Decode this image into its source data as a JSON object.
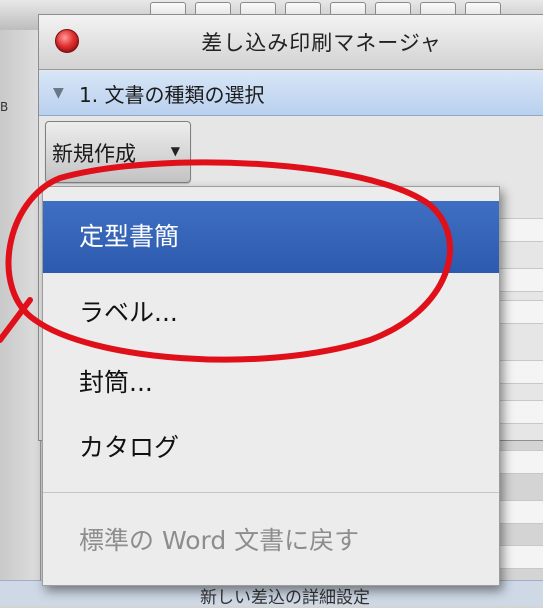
{
  "palette": {
    "title": "差し込み印刷マネージャ",
    "section_title": "1. 文書の種類の選択",
    "new_doc_button": "新規作成"
  },
  "background": {
    "left_fragment": "B",
    "bottom_fragment": "新しい差込の詳細設定"
  },
  "menu": {
    "items": [
      {
        "label": "定型書簡",
        "state": "selected"
      },
      {
        "label": "ラベル...",
        "state": "normal"
      },
      {
        "label": "封筒...",
        "state": "normal"
      },
      {
        "label": "カタログ",
        "state": "normal"
      },
      {
        "label": "標準の Word 文書に戻す",
        "state": "disabled"
      }
    ]
  },
  "colors": {
    "selection": "#2f5fb3",
    "annotation": "#e0101a",
    "section_header": "#c7daf2"
  }
}
